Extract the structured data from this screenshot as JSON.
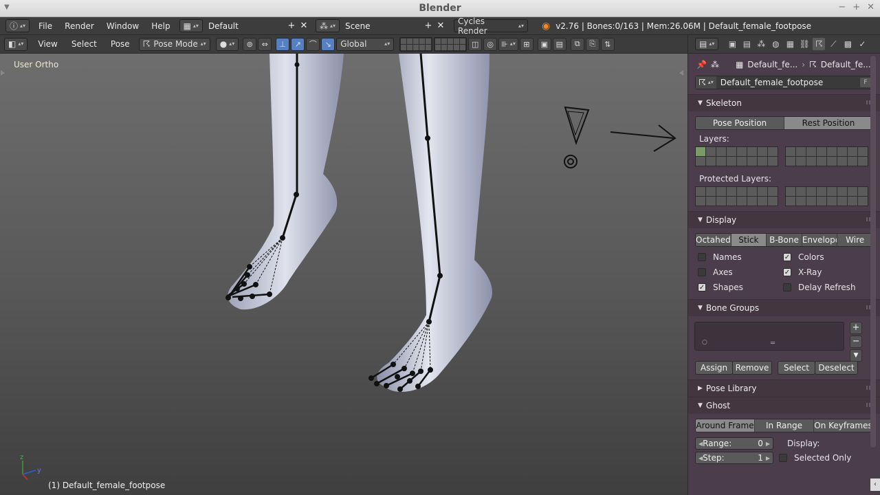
{
  "window": {
    "title": "Blender"
  },
  "info": {
    "menus": [
      "File",
      "Render",
      "Window",
      "Help"
    ],
    "layout": "Default",
    "scene": "Scene",
    "engine": "Cycles Render",
    "stats": "v2.76 | Bones:0/163 | Mem:26.06M | Default_female_footpose"
  },
  "view3d": {
    "menus": [
      "View",
      "Select",
      "Pose"
    ],
    "mode": "Pose Mode",
    "orientation": "Global",
    "viewport_label": "User Ortho",
    "status": "(1) Default_female_footpose",
    "axis_z": "z",
    "axis_y": "y"
  },
  "props": {
    "crumb_object": "Default_fe...",
    "crumb_armature": "Default_fe...",
    "datablock_name": "Default_female_footpose",
    "fake_user": "F",
    "skeleton": {
      "title": "Skeleton",
      "pose_position": "Pose Position",
      "rest_position": "Rest Position",
      "layers_label": "Layers:",
      "protected_label": "Protected Layers:"
    },
    "display": {
      "title": "Display",
      "types": [
        "Octahedr",
        "Stick",
        "B-Bone",
        "Envelope",
        "Wire"
      ],
      "active_type": "Stick",
      "options_left": [
        {
          "label": "Names",
          "checked": false
        },
        {
          "label": "Axes",
          "checked": false
        },
        {
          "label": "Shapes",
          "checked": true
        }
      ],
      "options_right": [
        {
          "label": "Colors",
          "checked": true
        },
        {
          "label": "X-Ray",
          "checked": true
        },
        {
          "label": "Delay Refresh",
          "checked": false
        }
      ]
    },
    "bone_groups": {
      "title": "Bone Groups",
      "assign": "Assign",
      "remove": "Remove",
      "select": "Select",
      "deselect": "Deselect"
    },
    "pose_library": {
      "title": "Pose Library"
    },
    "ghost": {
      "title": "Ghost",
      "types": [
        "Around Frame",
        "In Range",
        "On Keyframes"
      ],
      "active_type": "Around Frame",
      "range_label": "Range:",
      "range_value": "0",
      "step_label": "Step:",
      "step_value": "1",
      "display_label": "Display:",
      "selected_only": "Selected Only"
    }
  }
}
